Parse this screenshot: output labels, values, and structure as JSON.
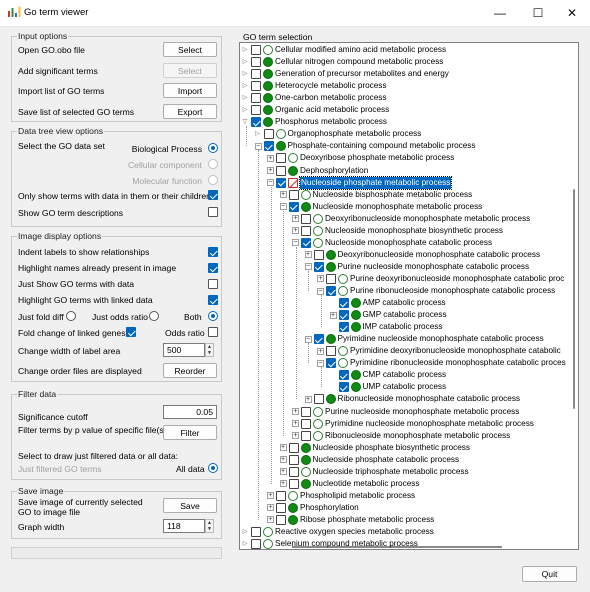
{
  "window": {
    "title": "Go term viewer",
    "minimize": "—",
    "maximize": "☐",
    "close": "✕"
  },
  "input_options": {
    "title": "Input options",
    "rows": [
      {
        "label": "Open GO.obo file",
        "button": "Select",
        "enabled": true
      },
      {
        "label": "Add significant terms",
        "button": "Select",
        "enabled": false
      },
      {
        "label": "Import list of GO terms",
        "button": "Import",
        "enabled": true
      },
      {
        "label": "Save list of selected GO terms",
        "button": "Export",
        "enabled": true
      }
    ]
  },
  "data_tree": {
    "title": "Data tree view options",
    "select_label": "Select the GO data set",
    "datasets": [
      {
        "label": "Biological Process",
        "selected": true,
        "enabled": true
      },
      {
        "label": "Cellular component",
        "selected": false,
        "enabled": false
      },
      {
        "label": "Molecular function",
        "selected": false,
        "enabled": false
      }
    ],
    "only_show_label": "Only show terms with data in them or their children",
    "only_show_checked": true,
    "show_desc_label": "Show GO term descriptions",
    "show_desc_checked": false
  },
  "image_display": {
    "title": "Image display options",
    "checks": [
      {
        "label": "Indent labels to show relationships",
        "checked": true
      },
      {
        "label": "Highlight names already present in image",
        "checked": true
      },
      {
        "label": "Just Show GO terms with data",
        "checked": false
      },
      {
        "label": "Highlight GO terms with linked data",
        "checked": true
      }
    ],
    "fold_radios": [
      {
        "label": "Just fold diff",
        "selected": false
      },
      {
        "label": "Just odds ratio",
        "selected": false
      },
      {
        "label": "Both",
        "selected": true
      }
    ],
    "fold_change_label": "Fold change of linked genes",
    "fold_change_checked": true,
    "odds_ratio_label": "Odds ratio",
    "odds_ratio_checked": false,
    "label_width_label": "Change width of label area",
    "label_width_value": "500",
    "order_label": "Change order files are displayed",
    "reorder_button": "Reorder"
  },
  "filter_data": {
    "title": "Filter data",
    "cutoff_label": "Significance cutoff",
    "cutoff_value": "0.05",
    "filter_terms_label": "Filter terms by p value of specific file(s)",
    "filter_button": "Filter",
    "draw_label": "Select to draw just filtered data or all data:",
    "just_filtered_label": "Just filtered GO terms",
    "all_data_label": "All data",
    "all_data_selected": true
  },
  "save_image": {
    "title": "Save image",
    "save_label": "Save image of currently selected GO to image file",
    "save_button": "Save",
    "graph_width_label": "Graph width",
    "graph_width_value": "118"
  },
  "tree_panel": {
    "title": "GO term selection",
    "nodes": [
      {
        "label": "Cellular modified amino acid metabolic process",
        "level": 0,
        "exp": "arrow",
        "checked": false,
        "circle": "empty"
      },
      {
        "label": "Cellular nitrogen compound metabolic process",
        "level": 0,
        "exp": "arrow",
        "checked": false,
        "circle": "full"
      },
      {
        "label": "Generation of precursor metabolites and energy",
        "level": 0,
        "exp": "arrow",
        "checked": false,
        "circle": "full"
      },
      {
        "label": "Heterocycle metabolic process",
        "level": 0,
        "exp": "arrow",
        "checked": false,
        "circle": "full"
      },
      {
        "label": "One-carbon metabolic process",
        "level": 0,
        "exp": "arrow",
        "checked": false,
        "circle": "full"
      },
      {
        "label": "Organic acid metabolic process",
        "level": 0,
        "exp": "arrow",
        "checked": false,
        "circle": "full"
      },
      {
        "label": "Phosphorus metabolic process",
        "level": 0,
        "exp": "arrow-down",
        "checked": true,
        "circle": "full"
      },
      {
        "label": "Organophosphate metabolic process",
        "level": 1,
        "exp": "arrow",
        "checked": false,
        "circle": "empty"
      },
      {
        "label": "Phosphate-containing compound metabolic process",
        "level": 1,
        "exp": "minus",
        "checked": true,
        "circle": "full"
      },
      {
        "label": "Deoxyribose phosphate metabolic process",
        "level": 2,
        "exp": "plus",
        "checked": false,
        "circle": "empty"
      },
      {
        "label": "Dephosphorylation",
        "level": 2,
        "exp": "plus",
        "checked": false,
        "circle": "full"
      },
      {
        "label": "Nucleoside phosphate metabolic process",
        "level": 2,
        "exp": "minus",
        "checked": true,
        "circle": "x",
        "selected": true
      },
      {
        "label": "Nucleoside bisphosphate metabolic process",
        "level": 3,
        "exp": "plus",
        "checked": false,
        "circle": "empty"
      },
      {
        "label": "Nucleoside monophosphate metabolic process",
        "level": 3,
        "exp": "minus",
        "checked": true,
        "circle": "full"
      },
      {
        "label": "Deoxyribonucleoside monophosphate metabolic process",
        "level": 4,
        "exp": "plus",
        "checked": false,
        "circle": "empty"
      },
      {
        "label": "Nucleoside monophosphate biosynthetic process",
        "level": 4,
        "exp": "plus",
        "checked": false,
        "circle": "empty"
      },
      {
        "label": "Nucleoside monophosphate catabolic process",
        "level": 4,
        "exp": "minus",
        "checked": true,
        "circle": "empty"
      },
      {
        "label": "Deoxyribonucleoside monophosphate catabolic process",
        "level": 5,
        "exp": "plus",
        "checked": false,
        "circle": "full"
      },
      {
        "label": "Purine nucleoside monophosphate catabolic process",
        "level": 5,
        "exp": "minus",
        "checked": true,
        "circle": "full"
      },
      {
        "label": "Purine deoxyribonucleoside monophosphate catabolic proc",
        "level": 6,
        "exp": "plus",
        "checked": false,
        "circle": "empty"
      },
      {
        "label": "Purine ribonucleoside monophosphate catabolic process",
        "level": 6,
        "exp": "minus",
        "checked": true,
        "circle": "empty"
      },
      {
        "label": "AMP catabolic process",
        "level": 7,
        "exp": "none",
        "checked": true,
        "circle": "full"
      },
      {
        "label": "GMP catabolic process",
        "level": 7,
        "exp": "plus",
        "checked": true,
        "circle": "full"
      },
      {
        "label": "IMP catabolic process",
        "level": 7,
        "exp": "none",
        "checked": true,
        "circle": "full"
      },
      {
        "label": "Pyrimidine nucleoside monophosphate catabolic process",
        "level": 5,
        "exp": "minus",
        "checked": true,
        "circle": "full"
      },
      {
        "label": "Pyrimidine deoxyribonucleoside monophosphate catabolic",
        "level": 6,
        "exp": "plus",
        "checked": false,
        "circle": "empty"
      },
      {
        "label": "Pyrimidine ribonucleoside monophosphate catabolic proces",
        "level": 6,
        "exp": "minus",
        "checked": true,
        "circle": "empty"
      },
      {
        "label": "CMP catabolic process",
        "level": 7,
        "exp": "none",
        "checked": true,
        "circle": "full"
      },
      {
        "label": "UMP catabolic process",
        "level": 7,
        "exp": "none",
        "checked": true,
        "circle": "full"
      },
      {
        "label": "Ribonucleoside monophosphate catabolic process",
        "level": 5,
        "exp": "plus",
        "checked": false,
        "circle": "full"
      },
      {
        "label": "Purine nucleoside monophosphate metabolic process",
        "level": 4,
        "exp": "plus",
        "checked": false,
        "circle": "empty"
      },
      {
        "label": "Pyrimidine nucleoside monophosphate metabolic process",
        "level": 4,
        "exp": "plus",
        "checked": false,
        "circle": "empty"
      },
      {
        "label": "Ribonucleoside monophosphate metabolic process",
        "level": 4,
        "exp": "plus",
        "checked": false,
        "circle": "empty"
      },
      {
        "label": "Nucleoside phosphate biosynthetic process",
        "level": 3,
        "exp": "plus",
        "checked": false,
        "circle": "full"
      },
      {
        "label": "Nucleoside phosphate catabolic process",
        "level": 3,
        "exp": "plus",
        "checked": false,
        "circle": "full"
      },
      {
        "label": "Nucleoside triphosphate metabolic process",
        "level": 3,
        "exp": "plus",
        "checked": false,
        "circle": "empty"
      },
      {
        "label": "Nucleotide metabolic process",
        "level": 3,
        "exp": "plus",
        "checked": false,
        "circle": "full"
      },
      {
        "label": "Phospholipid metabolic process",
        "level": 2,
        "exp": "plus",
        "checked": false,
        "circle": "empty"
      },
      {
        "label": "Phosphorylation",
        "level": 2,
        "exp": "plus",
        "checked": false,
        "circle": "full"
      },
      {
        "label": "Ribose phosphate metabolic process",
        "level": 2,
        "exp": "plus",
        "checked": false,
        "circle": "full"
      },
      {
        "label": "Reactive oxygen species metabolic process",
        "level": 0,
        "exp": "arrow",
        "checked": false,
        "circle": "empty"
      },
      {
        "label": "Selenium compound metabolic process",
        "level": 0,
        "exp": "arrow",
        "checked": false,
        "circle": "empty"
      }
    ]
  },
  "quit_button": "Quit",
  "colors": {
    "accent": "#0067c0",
    "circle_green": "#118a14",
    "cross_red": "#c62828"
  }
}
